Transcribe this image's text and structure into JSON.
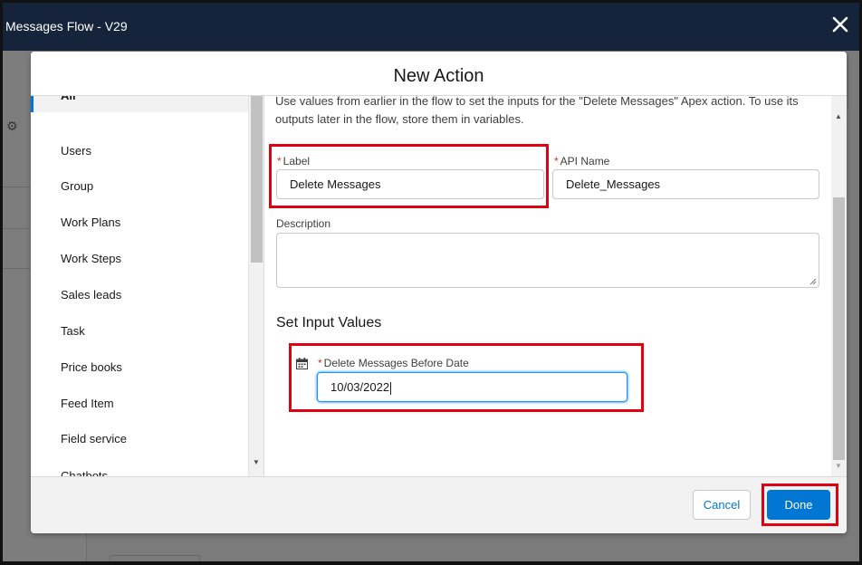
{
  "app": {
    "title": "Messages Flow - V29"
  },
  "modal": {
    "title": "New Action",
    "intro": "Use values from earlier in the flow to set the inputs for the \"Delete Messages\" Apex action. To use its outputs later in the flow, store them in variables."
  },
  "categories": {
    "items": [
      {
        "label": "All",
        "active": true
      },
      {
        "label": "Users"
      },
      {
        "label": "Group"
      },
      {
        "label": "Work Plans"
      },
      {
        "label": "Work Steps"
      },
      {
        "label": "Sales leads"
      },
      {
        "label": "Task"
      },
      {
        "label": "Price books"
      },
      {
        "label": "Feed Item"
      },
      {
        "label": "Field service"
      },
      {
        "label": "Chatbots"
      }
    ]
  },
  "form": {
    "label_field": {
      "label": "Label",
      "value": "Delete Messages"
    },
    "api_name_field": {
      "label": "API Name",
      "value": "Delete_Messages"
    },
    "description_field": {
      "label": "Description",
      "value": ""
    },
    "required_marker": "*",
    "section_title": "Set Input Values",
    "date_field": {
      "label": "Delete Messages Before Date",
      "value": "10/03/2022",
      "icon": "calendar-icon"
    }
  },
  "footer": {
    "cancel_label": "Cancel",
    "done_label": "Done"
  },
  "colors": {
    "header_bg": "#16243b",
    "brand_blue": "#0176d3",
    "highlight_red": "#e0000f",
    "required_red": "#c23934"
  }
}
